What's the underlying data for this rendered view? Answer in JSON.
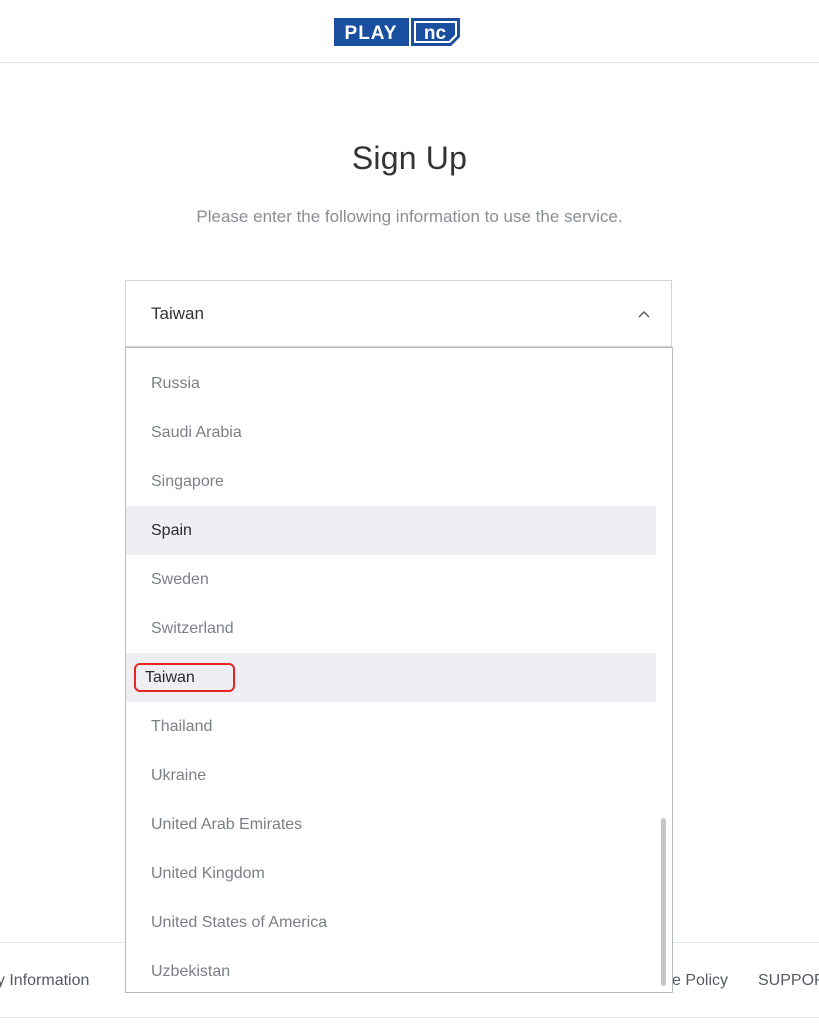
{
  "header": {
    "logo_text_play": "PLAY",
    "logo_text_nc": "nc",
    "logo_color": "#1a4fa0"
  },
  "main": {
    "title": "Sign Up",
    "subtitle": "Please enter the following information to use the service."
  },
  "country_select": {
    "value": "Taiwan",
    "expanded": true,
    "options": [
      {
        "label": "Russia"
      },
      {
        "label": "Saudi Arabia"
      },
      {
        "label": "Singapore"
      },
      {
        "label": "Spain"
      },
      {
        "label": "Sweden"
      },
      {
        "label": "Switzerland"
      },
      {
        "label": "Taiwan"
      },
      {
        "label": "Thailand"
      },
      {
        "label": "Ukraine"
      },
      {
        "label": "United Arab Emirates"
      },
      {
        "label": "United Kingdom"
      },
      {
        "label": "United States of America"
      },
      {
        "label": "Uzbekistan"
      }
    ],
    "hovered_option": "Spain",
    "selected_option": "Taiwan",
    "highlight_color": "#e8261f"
  },
  "footer": {
    "company_info_partial": "ny Information",
    "policy_partial": "e Policy",
    "support_partial": "SUPPOR"
  }
}
